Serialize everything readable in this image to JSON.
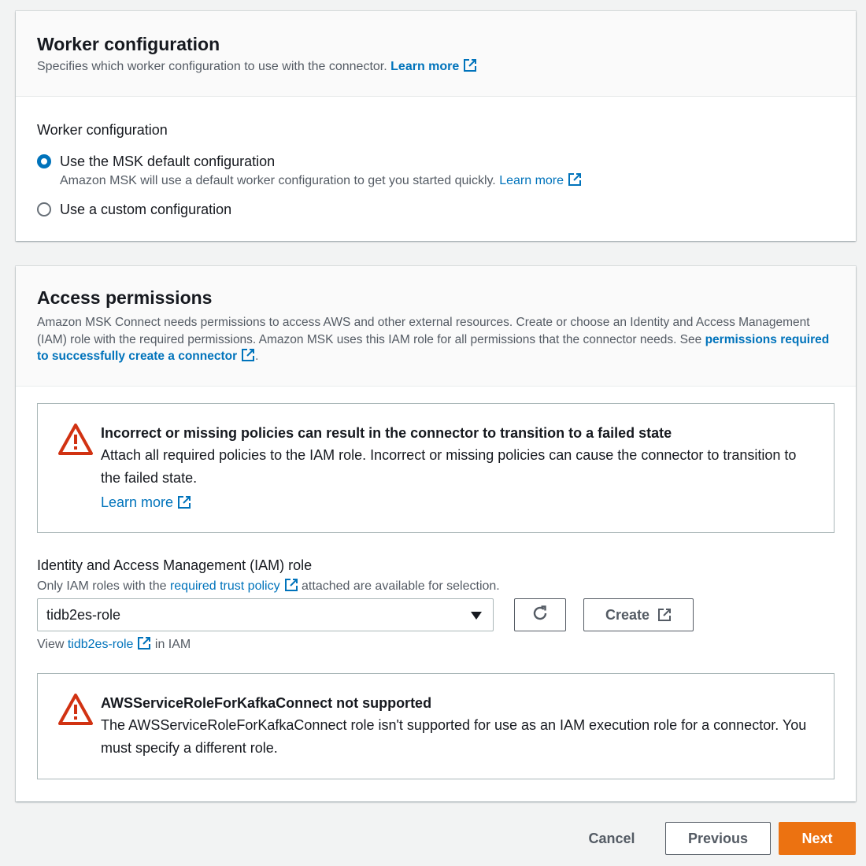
{
  "worker_panel": {
    "title": "Worker configuration",
    "description": "Specifies which worker configuration to use with the connector.",
    "learn_more": "Learn more",
    "field_label": "Worker configuration",
    "options": [
      {
        "label": "Use the MSK default configuration",
        "description": "Amazon MSK will use a default worker configuration to get you started quickly.",
        "learn_more": "Learn more",
        "selected": true
      },
      {
        "label": "Use a custom configuration",
        "selected": false
      }
    ]
  },
  "access_panel": {
    "title": "Access permissions",
    "description": "Amazon MSK Connect needs permissions to access AWS and other external resources. Create or choose an Identity and Access Management (IAM) role with the required permissions. Amazon MSK uses this IAM role for all permissions that the connector needs. See",
    "description_link": "permissions required to successfully create a connector",
    "description_end": ".",
    "warning_policies": {
      "title": "Incorrect or missing policies can result in the connector to transition to a failed state",
      "text": "Attach all required policies to the IAM role. Incorrect or missing policies can cause the connector to transition to the failed state.",
      "learn_more": "Learn more"
    },
    "iam_role": {
      "label": "Identity and Access Management (IAM) role",
      "hint_before": "Only IAM roles with the",
      "hint_link": "required trust policy",
      "hint_after": "attached are available for selection.",
      "selected_value": "tidb2es-role",
      "create_label": "Create",
      "view_before": "View",
      "view_link": "tidb2es-role",
      "view_after": "in IAM"
    },
    "warning_role": {
      "title": "AWSServiceRoleForKafkaConnect not supported",
      "text": "The AWSServiceRoleForKafkaConnect role isn't supported for use as an IAM execution role for a connector. You must specify a different role."
    }
  },
  "footer": {
    "cancel": "Cancel",
    "previous": "Previous",
    "next": "Next"
  },
  "icons": {
    "external": "external-link-icon",
    "warning": "warning-icon",
    "refresh": "refresh-icon",
    "caret": "caret-down-icon"
  },
  "colors": {
    "link": "#0073bb",
    "warning": "#d13212",
    "primary": "#ec7211",
    "radio": "#0073bb"
  }
}
